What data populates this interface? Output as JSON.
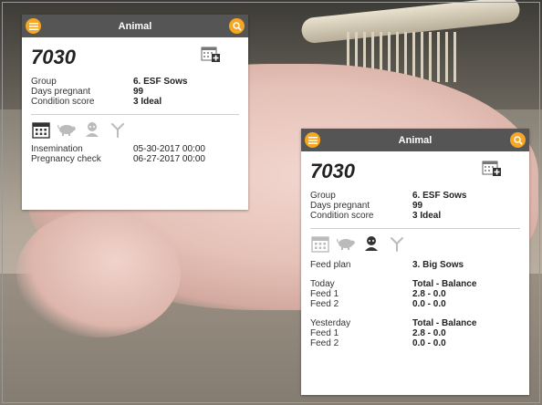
{
  "card1": {
    "title": "Animal",
    "animal_id": "7030",
    "fields": [
      {
        "label": "Group",
        "value": "6. ESF Sows"
      },
      {
        "label": "Days pregnant",
        "value": "99"
      },
      {
        "label": "Condition score",
        "value": "3 Ideal"
      }
    ],
    "events": [
      {
        "label": "Insemination",
        "value": "05-30-2017 00:00"
      },
      {
        "label": "Pregnancy check",
        "value": "06-27-2017 00:00"
      }
    ]
  },
  "card2": {
    "title": "Animal",
    "animal_id": "7030",
    "fields": [
      {
        "label": "Group",
        "value": "6. ESF Sows"
      },
      {
        "label": "Days pregnant",
        "value": "99"
      },
      {
        "label": "Condition score",
        "value": "3 Ideal"
      }
    ],
    "feed_plan": {
      "label": "Feed plan",
      "value": "3. Big Sows"
    },
    "today": [
      {
        "label": "Today",
        "value": "Total - Balance"
      },
      {
        "label": "Feed 1",
        "value": "2.8 - 0.0"
      },
      {
        "label": "Feed 2",
        "value": "0.0 - 0.0"
      }
    ],
    "yesterday": [
      {
        "label": "Yesterday",
        "value": "Total - Balance"
      },
      {
        "label": "Feed 1",
        "value": "2.8 - 0.0"
      },
      {
        "label": "Feed 2",
        "value": "0.0 - 0.0"
      }
    ]
  },
  "colors": {
    "accent": "#f5a623",
    "topbar": "#555555"
  },
  "icons": [
    "menu-icon",
    "search-icon",
    "add-calendar-icon",
    "calendar-tab-icon",
    "pig-tab-icon",
    "feeder-tab-icon",
    "branch-tab-icon"
  ]
}
